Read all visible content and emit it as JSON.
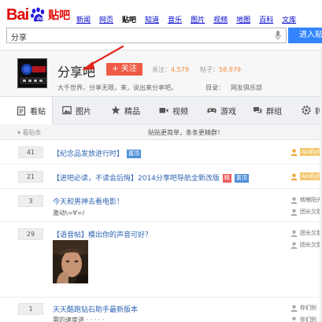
{
  "header": {
    "logo": {
      "bai": "Bai",
      "du": "du",
      "tieba": "贴吧"
    },
    "nav": [
      "新闻",
      "网页",
      "贴吧",
      "知道",
      "音乐",
      "图片",
      "视频",
      "地图",
      "百科",
      "文库"
    ],
    "nav_current": "贴吧",
    "search": {
      "value": "分享",
      "button": "进入贴吧"
    }
  },
  "forum": {
    "name": "分享吧",
    "follow_label": "+ 关注",
    "follow_stat_label": "关注：",
    "follow_count": "4,579",
    "post_stat_label": "帖子：",
    "post_count": "58,979",
    "slogan": "大千世界，分享无限，来，说出来分享吧。",
    "directory_label": "目录：",
    "directory_value": "网友俱乐部"
  },
  "tabs": [
    "看贴",
    "图片",
    "精品",
    "视频",
    "游戏",
    "群组",
    "转"
  ],
  "tabs_active": "看贴",
  "notice": {
    "collapse": "看贴条",
    "text": "贴贴更简单，条条更精群！"
  },
  "threads": [
    {
      "count": "41",
      "title": "【纪念品发放进行时】",
      "tag": "置顶",
      "author": "Andlyf",
      "author_style": "pill"
    },
    {
      "count": "21",
      "title": "【进吧必读，不读会后悔】2014分享吧导航全新改版",
      "tag_hot": "精",
      "tag": "置顶",
      "author": "Andlyf",
      "author_style": "pill"
    },
    {
      "count": "3",
      "title": "今天和男神去看电影！",
      "sub": "激动\\=∀=/",
      "author": "转眼阳光",
      "author2": "团长欠我"
    },
    {
      "count": "29",
      "title": "【语音帖】模出你的声音可好？",
      "author": "团长欠我",
      "author2": "团长欠我"
    },
    {
      "count": "1",
      "title": "天天酷跑钻石助手最新版本",
      "sub": "需的速度进 · · · · ·",
      "author": "你们别",
      "author2": "你们别"
    }
  ],
  "colors": {
    "brand_red": "#e10602",
    "brand_blue": "#2319dc",
    "link": "#2d64b3",
    "search_button": "#3385ff",
    "follow": "#ef5a46"
  },
  "icons": [
    "paw-logo-icon",
    "microphone-icon",
    "doc-icon",
    "image-icon",
    "star-icon",
    "video-icon",
    "gamepad-icon",
    "group-icon",
    "share-icon",
    "user-icon"
  ]
}
